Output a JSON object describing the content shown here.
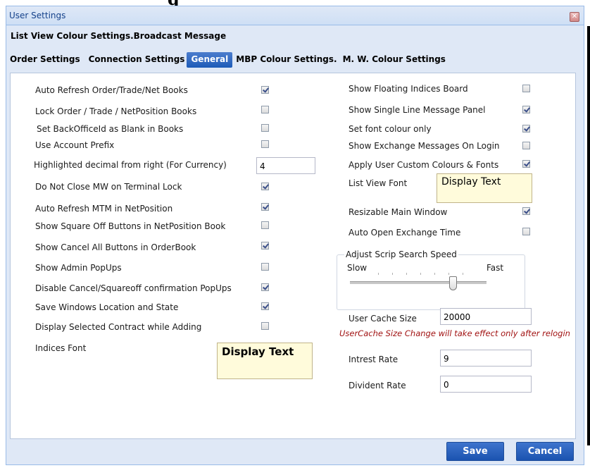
{
  "clip_title": "g",
  "window": {
    "title": "User Settings",
    "close_icon": "close-icon"
  },
  "tabs_row1": [
    "List View Colour Settings.",
    "Broadcast Message"
  ],
  "tabs_row2": [
    {
      "label": "Order Settings",
      "active": false
    },
    {
      "label": "Connection Settings",
      "active": false
    },
    {
      "label": "General",
      "active": true
    },
    {
      "label": "MBP Colour Settings.",
      "active": false
    },
    {
      "label": "M. W. Colour Settings",
      "active": false
    }
  ],
  "left": {
    "auto_refresh_books": {
      "label": "Auto Refresh Order/Trade/Net Books",
      "checked": true
    },
    "lock_books": {
      "label": "Lock Order / Trade / NetPosition Books",
      "checked": false
    },
    "backoffice_blank": {
      "label": "Set BackOfficeId as Blank in Books",
      "checked": false
    },
    "account_prefix": {
      "label": "Use Account Prefix",
      "checked": false
    },
    "highlighted_decimal": {
      "label": "Highlighted decimal from right (For Currency)",
      "value": "4"
    },
    "no_close_mw": {
      "label": "Do Not Close MW on Terminal Lock",
      "checked": true
    },
    "auto_refresh_mtm": {
      "label": "Auto Refresh MTM in NetPosition",
      "checked": true
    },
    "square_off_buttons": {
      "label": "Show Square Off Buttons in NetPosition Book",
      "checked": false
    },
    "cancel_all_buttons": {
      "label": "Show Cancel All Buttons in OrderBook",
      "checked": true
    },
    "admin_popups": {
      "label": "Show Admin PopUps",
      "checked": false
    },
    "disable_confirm": {
      "label": "Disable Cancel/Squareoff confirmation  PopUps",
      "checked": true
    },
    "save_windows": {
      "label": "Save Windows Location and State",
      "checked": true
    },
    "display_selected": {
      "label": "Display Selected Contract while Adding",
      "checked": false
    },
    "indices_font": {
      "label": "Indices Font",
      "display_text": "Display Text"
    }
  },
  "right": {
    "floating_indices": {
      "label": "Show Floating Indices Board",
      "checked": false
    },
    "single_line_panel": {
      "label": "Show Single Line Message Panel",
      "checked": true
    },
    "font_colour_only": {
      "label": "Set font colour only",
      "checked": true
    },
    "exchange_messages": {
      "label": "Show Exchange Messages On Login",
      "checked": false
    },
    "custom_colours": {
      "label": "Apply User Custom Colours & Fonts",
      "checked": true
    },
    "list_view_font": {
      "label": "List View Font",
      "display_text": "Display Text"
    },
    "resizable_main": {
      "label": "Resizable Main Window",
      "checked": true
    },
    "auto_open_exchange": {
      "label": "Auto Open Exchange Time",
      "checked": false
    },
    "scrip_search": {
      "legend": "Adjust Scrip Search Speed",
      "slow": "Slow",
      "fast": "Fast",
      "level": 0.76
    },
    "user_cache": {
      "label": "User Cache Size",
      "value": "20000"
    },
    "cache_warning": "UserCache Size Change will take effect only after relogin",
    "interest_rate": {
      "label": "Intrest Rate",
      "value": "9"
    },
    "dividend_rate": {
      "label": "Divident Rate",
      "value": "0"
    }
  },
  "buttons": {
    "save": "Save",
    "cancel": "Cancel"
  }
}
